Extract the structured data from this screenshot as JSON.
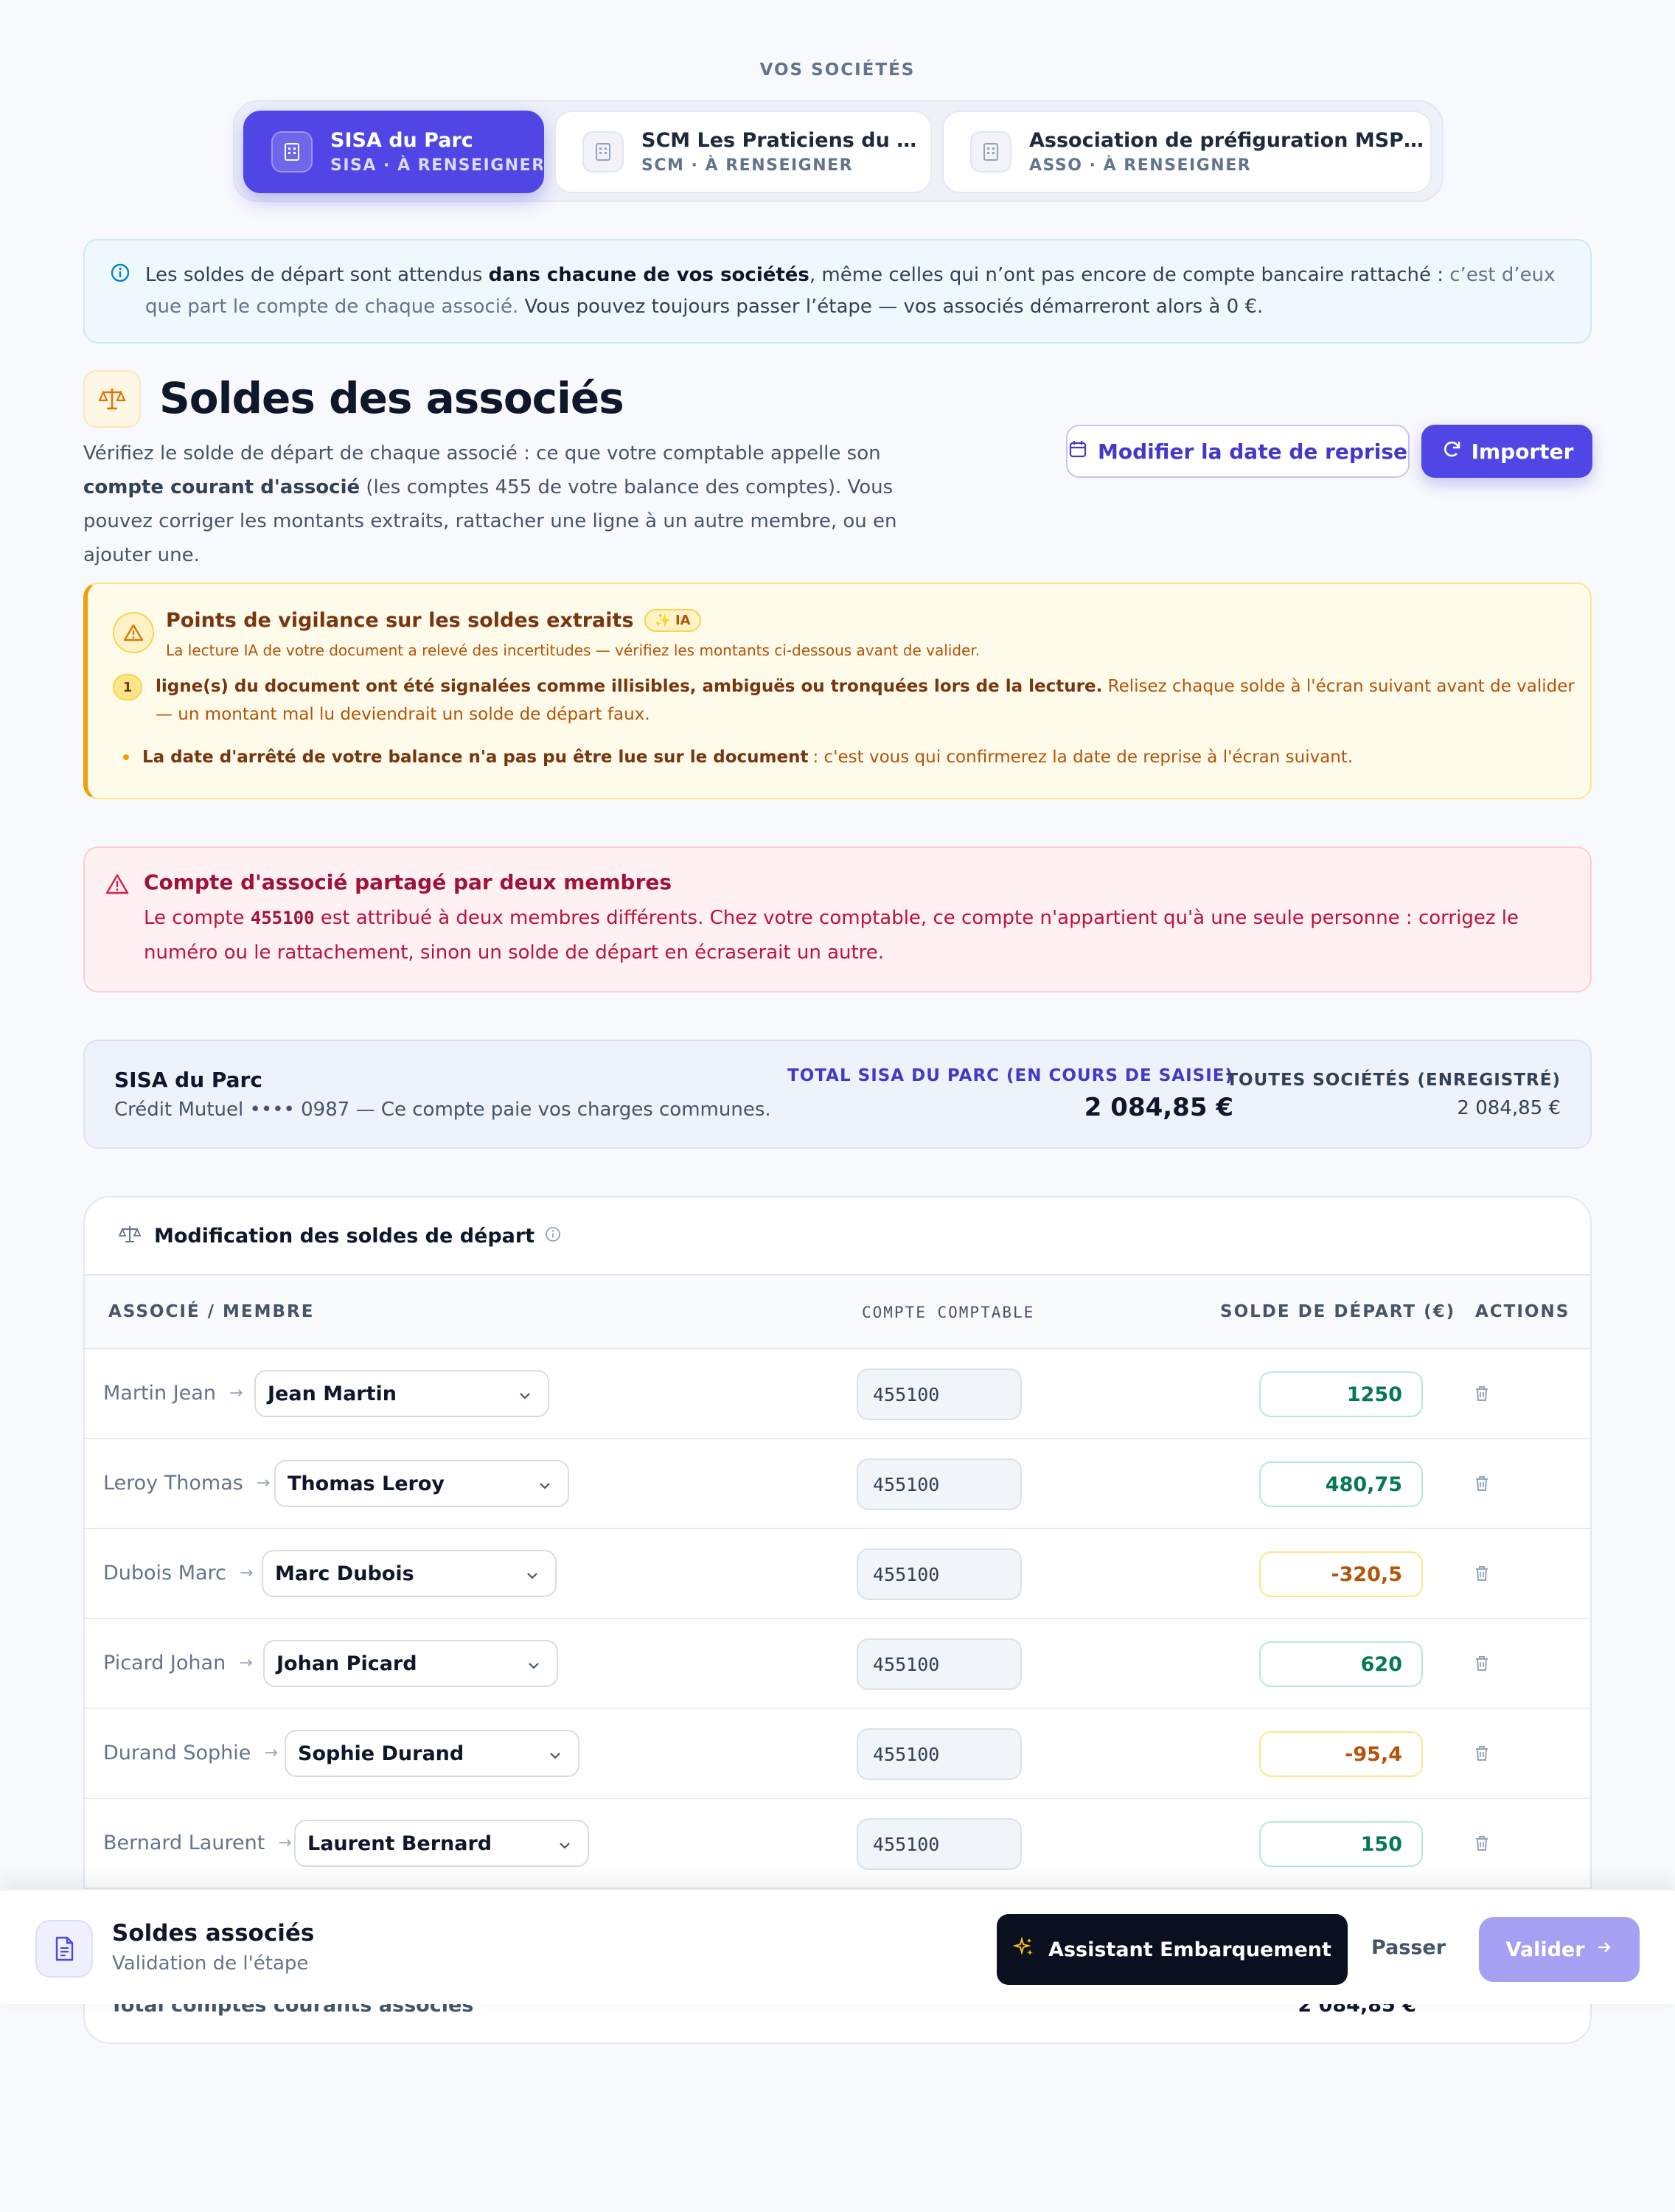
{
  "header": {
    "title": "VOS SOCIÉTÉS"
  },
  "companies": [
    {
      "name": "SISA du Parc",
      "sub": "SISA · À RENSEIGNER",
      "icon": "building-icon",
      "active": true
    },
    {
      "name": "SCM Les Praticiens du Parc",
      "sub": "SCM · À RENSEIGNER",
      "icon": "building-icon",
      "active": false
    },
    {
      "name": "Association de préfiguration MSP d...",
      "sub": "ASSO · À RENSEIGNER",
      "icon": "building-icon",
      "active": false
    }
  ],
  "info": {
    "p1": "Les soldes de départ sont attendus ",
    "bold": "dans chacune de vos sociétés",
    "p2": ", même celles qui n’ont pas encore de compte bancaire rattaché : ",
    "muted": "c’est d’eux que part le compte de chaque associé.",
    "p3": " Vous pouvez toujours passer l’étape — vos associés démarreront alors à 0 €."
  },
  "section": {
    "title": "Soldes des associés",
    "desc_1": "Vérifiez le solde de départ de chaque associé : ce que votre comptable appelle son ",
    "desc_bold": "compte courant d'associé",
    "desc_2": " (les comptes 455 de votre balance des comptes). Vous pouvez corriger les montants extraits, rattacher une ligne à un autre membre, ou en ajouter une.",
    "btn_date": "Modifier la date de reprise",
    "btn_import": "Importer"
  },
  "vigilance": {
    "title": "Points de vigilance sur les soldes extraits",
    "badge": "IA",
    "subtitle": "La lecture IA de votre document a relevé des incertitudes — vérifiez les montants ci-dessous avant de valider.",
    "count": "1",
    "row1_bold": "ligne(s) du document ont été signalées comme illisibles, ambiguës ou tronquées lors de la lecture.",
    "row1_text": " Relisez chaque solde à l'écran suivant avant de valider — un montant mal lu deviendrait un solde de départ faux.",
    "row2_bold": "La date d'arrêté de votre balance n'a pas pu être lue sur le document",
    "row2_text": " : c'est vous qui confirmerez la date de reprise à l'écran suivant."
  },
  "error": {
    "title": "Compte d'associé partagé par deux membres",
    "t1": "Le compte ",
    "code": "455100",
    "t2": " est attribué à deux membres différents. Chez votre comptable, ce compte n'appartient qu'à une seule personne : corrigez le numéro ou le rattachement, sinon un solde de départ en écraserait un autre."
  },
  "summary": {
    "name": "SISA du Parc",
    "bank": "Crédit Mutuel •••• 0987 — Ce compte paie vos charges communes.",
    "total_label": "TOTAL SISA DU PARC (EN COURS DE SAISIE)",
    "total_value": "2 084,85 €",
    "all_label": "TOUTES SOCIÉTÉS (ENREGISTRÉ)",
    "all_value": "2 084,85 €"
  },
  "table": {
    "title": "Modification des soldes de départ",
    "headers": {
      "member": "ASSOCIÉ / MEMBRE",
      "account": "COMPTE COMPTABLE",
      "balance": "SOLDE DE DÉPART (€)",
      "actions": "ACTIONS"
    },
    "rows": [
      {
        "original": "Martin Jean",
        "member": "Jean Martin",
        "account": "455100",
        "amount": "1250",
        "negative": false
      },
      {
        "original": "Leroy Thomas",
        "member": "Thomas Leroy",
        "account": "455100",
        "amount": "480,75",
        "negative": false
      },
      {
        "original": "Dubois Marc",
        "member": "Marc Dubois",
        "account": "455100",
        "amount": "-320,5",
        "negative": true
      },
      {
        "original": "Picard Johan",
        "member": "Johan Picard",
        "account": "455100",
        "amount": "620",
        "negative": false
      },
      {
        "original": "Durand Sophie",
        "member": "Sophie Durand",
        "account": "455100",
        "amount": "-95,4",
        "negative": true
      },
      {
        "original": "Bernard Laurent",
        "member": "Laurent Bernard",
        "account": "455100",
        "amount": "150",
        "negative": false
      }
    ],
    "footer_label": "Total comptes courants associés",
    "footer_value": "2 084,85 €"
  },
  "bottom_bar": {
    "title": "Soldes associés",
    "subtitle": "Validation de l'étape",
    "assistant": "Assistant Embarquement",
    "skip": "Passer",
    "validate": "Valider"
  },
  "colors": {
    "accent": "#5046e5",
    "warning": "#f59e0b",
    "danger": "#be123c",
    "positive": "#047857"
  }
}
